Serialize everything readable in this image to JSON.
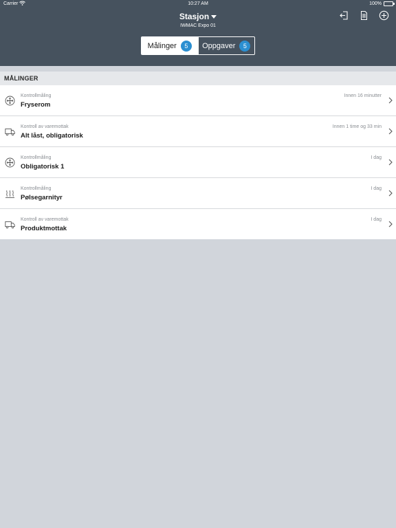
{
  "status_bar": {
    "carrier": "Carrier",
    "time": "10:27 AM",
    "battery": "100%"
  },
  "nav": {
    "title": "Stasjon",
    "subtitle": "IWMAC Expo 01",
    "actions": [
      "exit-icon",
      "document-icon",
      "add-circle-icon"
    ]
  },
  "segments": [
    {
      "label": "Målinger",
      "count": "5",
      "active": true
    },
    {
      "label": "Oppgaver",
      "count": "5",
      "active": false
    }
  ],
  "section": {
    "title": "MÅLINGER"
  },
  "items": [
    {
      "icon": "snowflake-icon",
      "subtitle": "Kontrollmåling",
      "title": "Fryserom",
      "time": "Innen 16 minutter"
    },
    {
      "icon": "truck-icon",
      "subtitle": "Kontroll av varemottak",
      "title": "Alt låst, obligatorisk",
      "time": "Innen 1 time og 33 min"
    },
    {
      "icon": "snowflake-icon",
      "subtitle": "Kontrollmåling",
      "title": "Obligatorisk 1",
      "time": "I dag"
    },
    {
      "icon": "heat-icon",
      "subtitle": "Kontrollmåling",
      "title": "Pølsegarnityr",
      "time": "I dag"
    },
    {
      "icon": "truck-icon",
      "subtitle": "Kontroll av varemottak",
      "title": "Produktmottak",
      "time": "I dag"
    }
  ],
  "colors": {
    "header_bg": "#46525e",
    "badge": "#2b8fd1",
    "background": "#d1d5db"
  }
}
